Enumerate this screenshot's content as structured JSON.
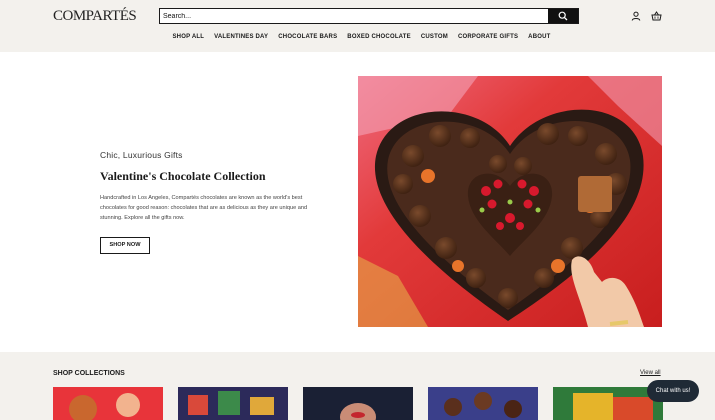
{
  "header": {
    "logo": "COMPARTÉS",
    "search": {
      "placeholder": "Search..."
    }
  },
  "nav": {
    "items": [
      {
        "label": "SHOP ALL"
      },
      {
        "label": "VALENTINES DAY"
      },
      {
        "label": "CHOCOLATE BARS"
      },
      {
        "label": "BOXED CHOCOLATE"
      },
      {
        "label": "CUSTOM"
      },
      {
        "label": "CORPORATE GIFTS"
      },
      {
        "label": "ABOUT"
      }
    ]
  },
  "hero": {
    "eyebrow": "Chic, Luxurious Gifts",
    "title": "Valentine's Chocolate Collection",
    "description": "Handcrafted in Los Angeles, Compartés chocolates are known as the world's best chocolates for good reason: chocolates that are as delicious as they are unique and stunning. Explore all the gifts now.",
    "cta": "SHOP NOW"
  },
  "collections": {
    "title": "SHOP COLLECTIONS",
    "view_all": "View all"
  },
  "chat": {
    "label": "Chat with us!"
  },
  "colors": {
    "header_bg": "#f3f1ed",
    "hero_red": "#d92a2a",
    "chat_bg": "#1f2a36"
  }
}
